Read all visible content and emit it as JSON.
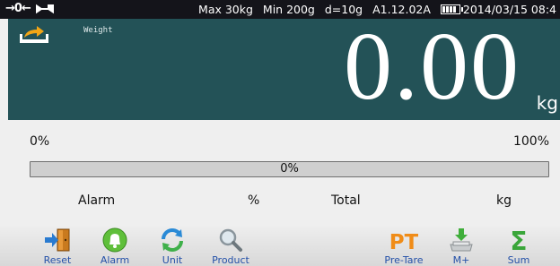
{
  "status": {
    "zero_indicator": "→0←",
    "max": "Max 30kg",
    "min": "Min 200g",
    "division": "d=10g",
    "version": "A1.12.02A",
    "datetime": "2014/03/15 08:4"
  },
  "display": {
    "label": "Weight",
    "value": "0.00",
    "unit": "kg"
  },
  "progress": {
    "min_label": "0%",
    "max_label": "100%",
    "text": "0%",
    "fraction": 0
  },
  "info": {
    "alarm_label": "Alarm",
    "alarm_unit": "%",
    "total_label": "Total",
    "total_unit": "kg"
  },
  "toolbar": [
    {
      "label": "Reset",
      "icon": "exit-door-icon"
    },
    {
      "label": "Alarm",
      "icon": "bell-icon"
    },
    {
      "label": "Unit",
      "icon": "refresh-icon"
    },
    {
      "label": "Product",
      "icon": "magnifier-icon"
    },
    {
      "label": "Pre-Tare",
      "icon": "pt-icon"
    },
    {
      "label": "M+",
      "icon": "memory-add-icon"
    },
    {
      "label": "Sum",
      "icon": "sigma-icon"
    }
  ],
  "colors": {
    "panel": "#235257",
    "statusbar": "#14141a",
    "toolbar_label": "#2350a8"
  }
}
